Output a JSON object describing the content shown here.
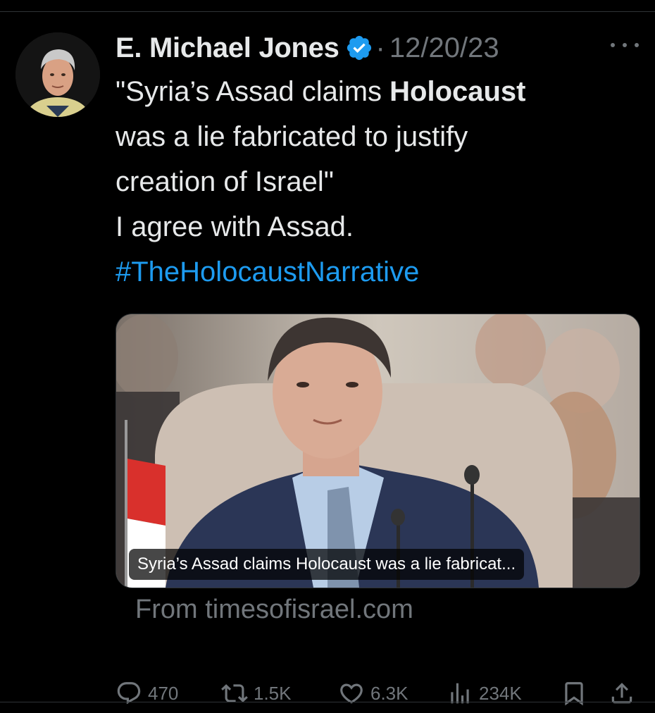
{
  "author": {
    "display_name": "E. Michael Jones",
    "verified": true
  },
  "timestamp": "12/20/23",
  "separator": "·",
  "tweet": {
    "line1_pre": "\"Syria’s Assad claims ",
    "line1_bold": "Holocaust",
    "line2": "was a lie fabricated to justify",
    "line3": "creation of Israel\"",
    "line4": "I agree with Assad.",
    "hashtag": "#TheHolocaustNarrative"
  },
  "card": {
    "caption": "Syria’s Assad claims Holocaust was a lie fabricat...",
    "source": "From timesofisrael.com"
  },
  "metrics": {
    "replies": "470",
    "reposts": "1.5K",
    "likes": "6.3K",
    "views": "234K"
  },
  "icons": {
    "more": "more-dots-icon",
    "verified": "verified-badge-icon",
    "reply": "reply-icon",
    "repost": "repost-icon",
    "like": "heart-icon",
    "views": "views-icon",
    "bookmark": "bookmark-icon",
    "share": "share-icon"
  },
  "colors": {
    "background": "#000000",
    "text": "#e7e9ea",
    "muted": "#71767b",
    "link": "#1d9bf0",
    "verified": "#1d9bf0"
  }
}
